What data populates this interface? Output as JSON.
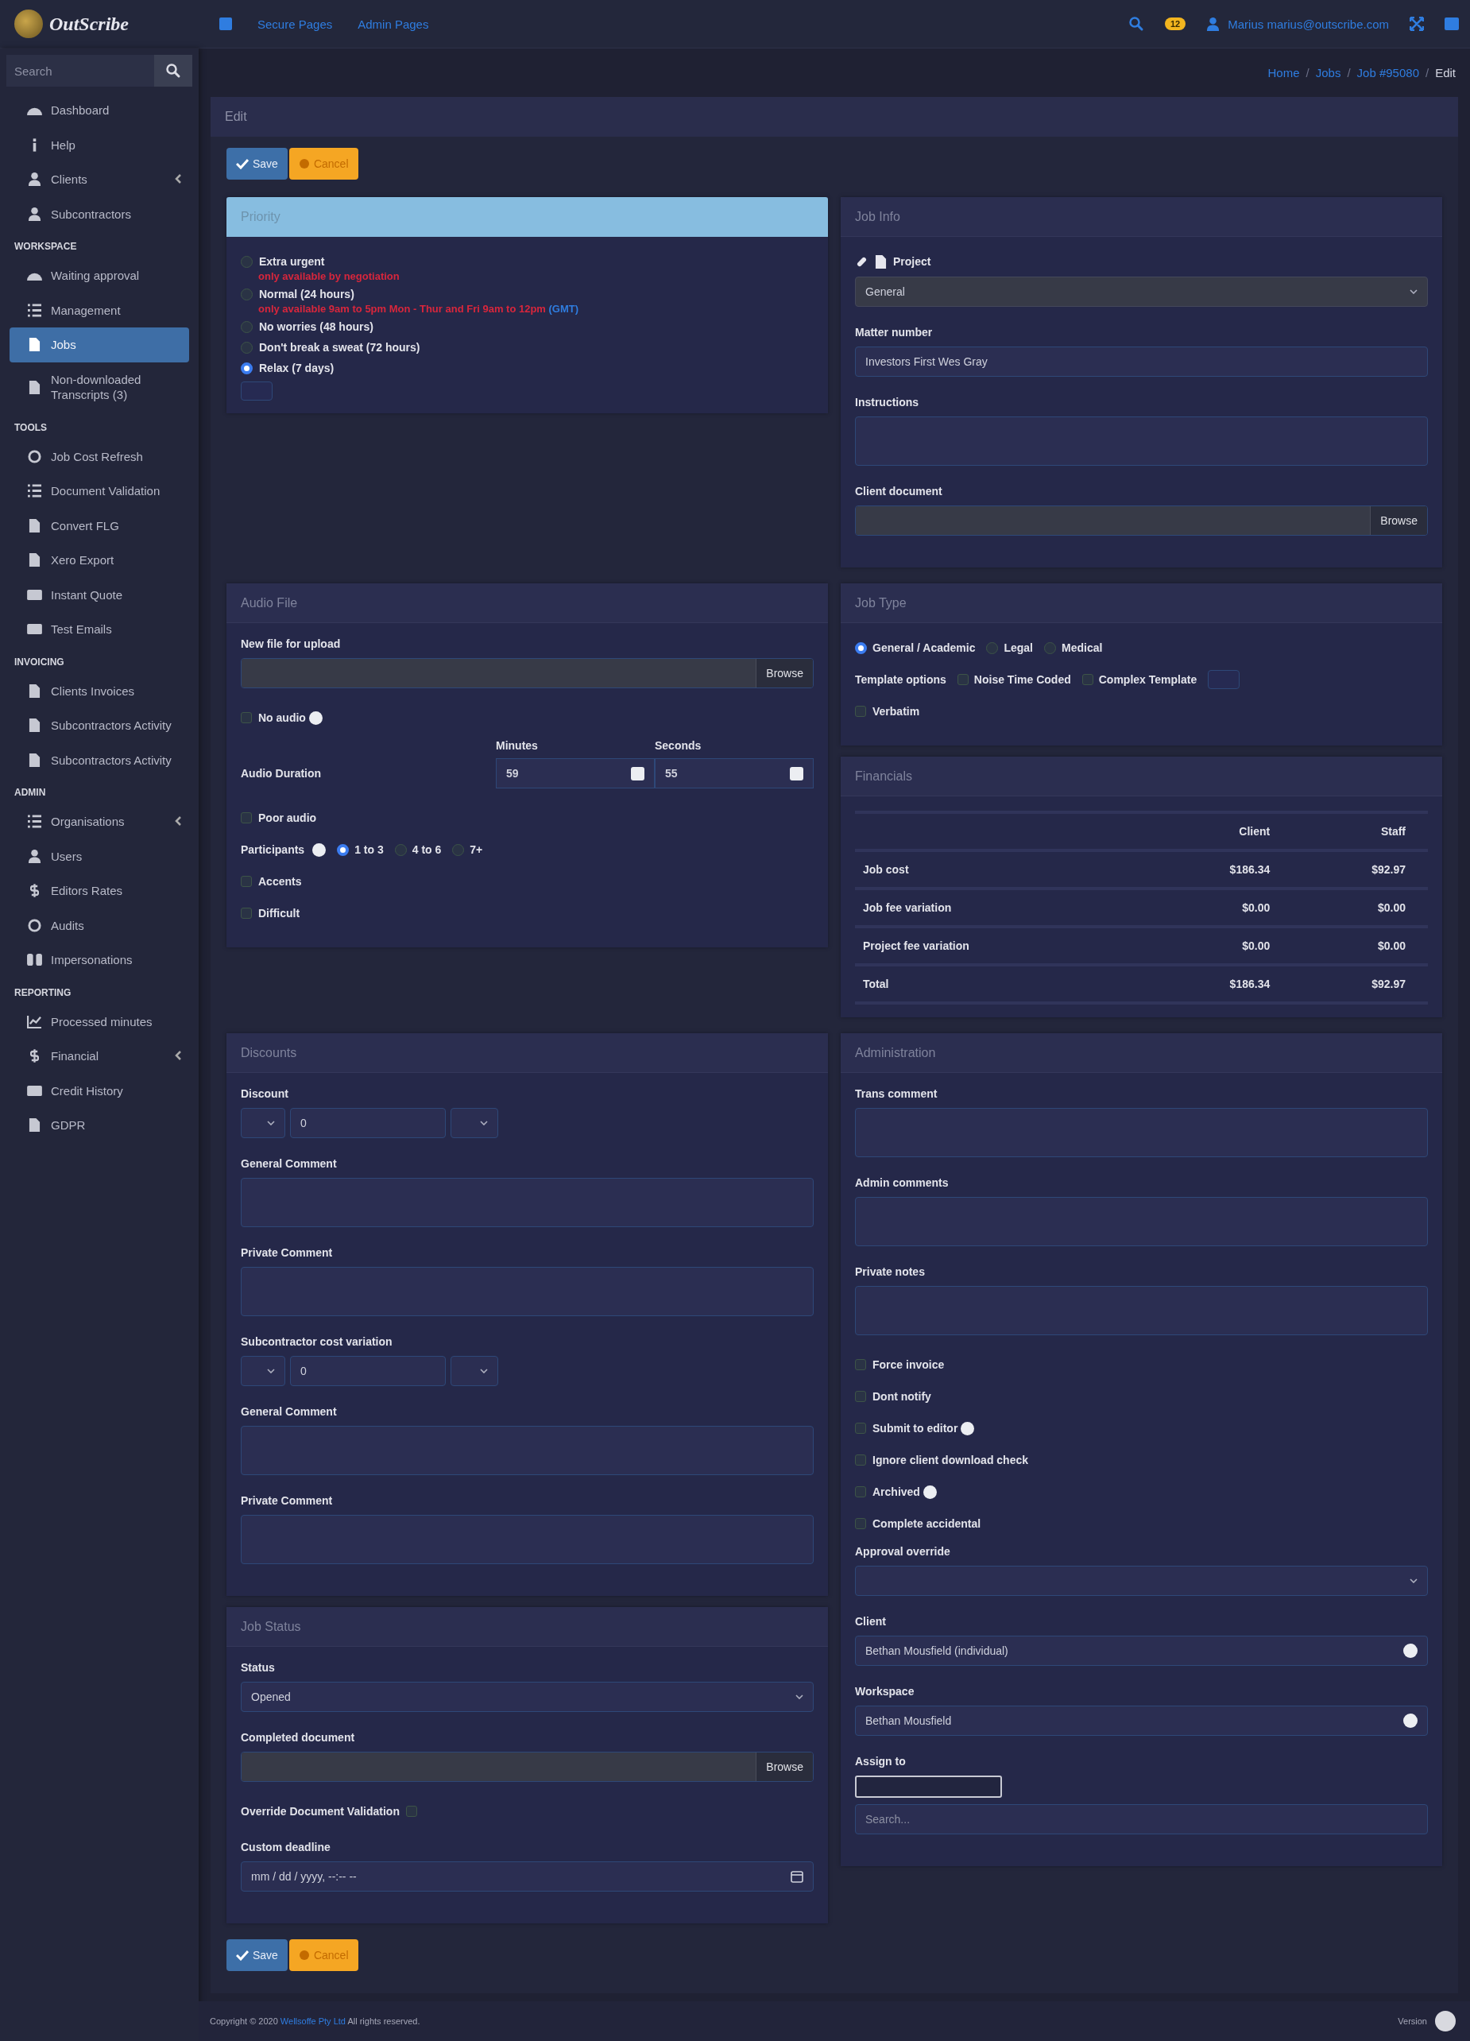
{
  "topbar": {
    "brand": "OutScribe",
    "nav": [
      "Secure Pages",
      "Admin Pages"
    ],
    "badge": "12",
    "user": "Marius marius@outscribe.com"
  },
  "sidebar": {
    "search_placeholder": "Search",
    "sections": [
      {
        "items": [
          {
            "label": "Dashboard",
            "selected": false,
            "has_submenu": false
          },
          {
            "label": "Help",
            "selected": false,
            "has_submenu": false
          },
          {
            "label": "Clients",
            "selected": false,
            "has_submenu": true
          },
          {
            "label": "Subcontractors",
            "selected": false,
            "has_submenu": false
          }
        ]
      },
      {
        "heading": "WORKSPACE",
        "items": [
          {
            "label": "Waiting approval",
            "selected": false,
            "has_submenu": false
          },
          {
            "label": "Management",
            "selected": false,
            "has_submenu": false
          },
          {
            "label": "Jobs",
            "selected": true,
            "has_submenu": false
          },
          {
            "label": "Non-downloaded Transcripts (3)",
            "selected": false,
            "has_submenu": false
          }
        ]
      },
      {
        "heading": "TOOLS",
        "items": [
          {
            "label": "Job Cost Refresh",
            "selected": false,
            "has_submenu": false
          },
          {
            "label": "Document Validation",
            "selected": false,
            "has_submenu": false
          },
          {
            "label": "Convert FLG",
            "selected": false,
            "has_submenu": false
          },
          {
            "label": "Xero Export",
            "selected": false,
            "has_submenu": false
          },
          {
            "label": "Instant Quote",
            "selected": false,
            "has_submenu": false
          },
          {
            "label": "Test Emails",
            "selected": false,
            "has_submenu": false
          }
        ]
      },
      {
        "heading": "INVOICING",
        "items": [
          {
            "label": "Clients Invoices",
            "selected": false,
            "has_submenu": false
          },
          {
            "label": "Subcontractors Activity",
            "selected": false,
            "has_submenu": false
          },
          {
            "label": "Subcontractors Activity",
            "selected": false,
            "has_submenu": false
          }
        ]
      },
      {
        "heading": "ADMIN",
        "items": [
          {
            "label": "Organisations",
            "selected": false,
            "has_submenu": true
          },
          {
            "label": "Users",
            "selected": false,
            "has_submenu": false
          },
          {
            "label": "Editors Rates",
            "selected": false,
            "has_submenu": false
          },
          {
            "label": "Audits",
            "selected": false,
            "has_submenu": false
          },
          {
            "label": "Impersonations",
            "selected": false,
            "has_submenu": false
          }
        ]
      },
      {
        "heading": "REPORTING",
        "items": [
          {
            "label": "Processed minutes",
            "selected": false,
            "has_submenu": false
          },
          {
            "label": "Financial",
            "selected": false,
            "has_submenu": true
          },
          {
            "label": "Credit History",
            "selected": false,
            "has_submenu": false
          },
          {
            "label": "GDPR",
            "selected": false,
            "has_submenu": false
          }
        ]
      }
    ]
  },
  "breadcrumb": [
    {
      "label": "Home",
      "link": true
    },
    {
      "separator": "/",
      "label": "Jobs",
      "link": true
    },
    {
      "separator": "/",
      "label": "Job #95080",
      "link": true
    },
    {
      "separator": "/",
      "label": "Edit",
      "link": false
    }
  ],
  "page_title": "Edit",
  "top_actions": [
    {
      "label": "Save",
      "kind": "save"
    },
    {
      "label": "Cancel",
      "kind": "cancel"
    }
  ],
  "bottom_actions": [
    {
      "label": "Save",
      "kind": "save"
    },
    {
      "label": "Cancel",
      "kind": "cancel"
    }
  ],
  "rows": [
    {
      "left": [
        {
          "title": "Priority",
          "highlighted": true,
          "fields": [
            {
              "kind": "radio",
              "label": "Extra urgent",
              "selected": false
            },
            {
              "kind": "note",
              "text": "only available by negotiation"
            },
            {
              "kind": "radio",
              "label": "Normal (24 hours)",
              "selected": false
            },
            {
              "kind": "note",
              "text": "only available 9am to 5pm Mon - Thur and Fri 9am to 12pm",
              "link": "(GMT)"
            },
            {
              "kind": "radio",
              "label": "No worries (48 hours)",
              "selected": false
            },
            {
              "kind": "radio",
              "label": "Don't break a sweat (72 hours)",
              "selected": false
            },
            {
              "kind": "radio",
              "label": "Relax (7 days)",
              "selected": true
            },
            {
              "kind": "blank-button"
            }
          ]
        }
      ],
      "right": [
        {
          "title": "Job Info",
          "highlighted": false,
          "fields": [
            {
              "kind": "project-select",
              "label": "Project",
              "value": "General"
            },
            {
              "kind": "input",
              "label": "Matter number",
              "value": "Investors First Wes Gray"
            },
            {
              "kind": "textarea",
              "label": "Instructions"
            },
            {
              "kind": "file",
              "label": "Client document",
              "button": "Browse"
            }
          ]
        }
      ]
    },
    {
      "left": [
        {
          "title": "Audio File",
          "highlighted": false,
          "fields": [
            {
              "kind": "file",
              "label": "New file for upload",
              "button": "Browse"
            },
            {
              "kind": "checkbox",
              "label": "No audio",
              "checked": false,
              "info": true
            },
            {
              "kind": "duration",
              "label": "Audio Duration",
              "columns": [
                {
                  "heading": "Minutes",
                  "value": "59"
                },
                {
                  "heading": "Seconds",
                  "value": "55"
                }
              ]
            },
            {
              "kind": "checkbox",
              "label": "Poor audio",
              "checked": false,
              "info": false
            },
            {
              "kind": "radio-row",
              "label": "Participants",
              "info": true,
              "options": [
                {
                  "label": "1 to 3",
                  "selected": true
                },
                {
                  "label": "4 to 6",
                  "selected": false
                },
                {
                  "label": "7+",
                  "selected": false
                }
              ]
            },
            {
              "kind": "checkbox",
              "label": "Accents",
              "checked": false,
              "info": false
            },
            {
              "kind": "checkbox",
              "label": "Difficult",
              "checked": false,
              "info": false
            }
          ]
        }
      ],
      "right": [
        {
          "title": "Job Type",
          "highlighted": false,
          "fields": [
            {
              "kind": "radio-row",
              "info": false,
              "options": [
                {
                  "label": "General / Academic",
                  "selected": true
                },
                {
                  "label": "Legal",
                  "selected": false
                },
                {
                  "label": "Medical",
                  "selected": false
                }
              ]
            },
            {
              "kind": "check-row",
              "label": "Template options",
              "options": [
                {
                  "label": "Noise Time Coded",
                  "checked": false
                },
                {
                  "label": "Complex Template",
                  "checked": false
                }
              ],
              "extra_button": true
            },
            {
              "kind": "checkbox",
              "label": "Verbatim",
              "checked": false,
              "info": false
            }
          ]
        },
        {
          "title": "Financials",
          "highlighted": false,
          "fields": [
            {
              "kind": "table",
              "columns": [
                "",
                "Client",
                "Staff"
              ],
              "rows": [
                [
                  "Job cost",
                  "$186.34",
                  "$92.97"
                ],
                [
                  "Job fee variation",
                  "$0.00",
                  "$0.00"
                ],
                [
                  "Project fee variation",
                  "$0.00",
                  "$0.00"
                ],
                [
                  "Total",
                  "$186.34",
                  "$92.97"
                ]
              ]
            }
          ]
        }
      ]
    },
    {
      "left": [
        {
          "title": "Discounts",
          "highlighted": false,
          "fields": [
            {
              "kind": "amount",
              "label": "Discount",
              "value": "0"
            },
            {
              "kind": "textarea",
              "label": "General Comment"
            },
            {
              "kind": "textarea",
              "label": "Private Comment"
            },
            {
              "kind": "amount",
              "label": "Subcontractor cost variation",
              "value": "0"
            },
            {
              "kind": "textarea",
              "label": "General Comment"
            },
            {
              "kind": "textarea",
              "label": "Private Comment"
            }
          ]
        },
        {
          "title": "Job Status",
          "highlighted": false,
          "fields": [
            {
              "kind": "select",
              "label": "Status",
              "value": "Opened"
            },
            {
              "kind": "file",
              "label": "Completed document",
              "button": "Browse"
            },
            {
              "kind": "inline-checkbox",
              "label": "Override Document Validation",
              "checked": false
            },
            {
              "kind": "datetime",
              "label": "Custom deadline",
              "value": "mm / dd / yyyy, --:-- --"
            }
          ]
        }
      ],
      "right": [
        {
          "title": "Administration",
          "highlighted": false,
          "fields": [
            {
              "kind": "textarea",
              "label": "Trans comment"
            },
            {
              "kind": "textarea",
              "label": "Admin comments"
            },
            {
              "kind": "textarea",
              "label": "Private notes"
            },
            {
              "kind": "checkbox",
              "label": "Force invoice",
              "checked": false,
              "info": false
            },
            {
              "kind": "checkbox",
              "label": "Dont notify",
              "checked": false,
              "info": false
            },
            {
              "kind": "checkbox",
              "label": "Submit to editor",
              "checked": false,
              "info": true
            },
            {
              "kind": "checkbox",
              "label": "Ignore client download check",
              "checked": false,
              "info": false
            },
            {
              "kind": "checkbox",
              "label": "Archived",
              "checked": false,
              "info": true
            },
            {
              "kind": "checkbox",
              "label": "Complete accidental",
              "checked": false,
              "info": false
            },
            {
              "kind": "select",
              "label": "Approval override"
            },
            {
              "kind": "clear-select",
              "label": "Client",
              "value": "Bethan Mousfield (individual)"
            },
            {
              "kind": "clear-select",
              "label": "Workspace",
              "value": "Bethan Mousfield"
            },
            {
              "kind": "assign",
              "label": "Assign to",
              "placeholder": "Search..."
            }
          ]
        }
      ]
    }
  ],
  "footer": {
    "text_before": "Copyright © 2020 ",
    "link": "Wellsoffe Pty Ltd",
    "text_after": " All rights reserved.",
    "version": "Version"
  }
}
